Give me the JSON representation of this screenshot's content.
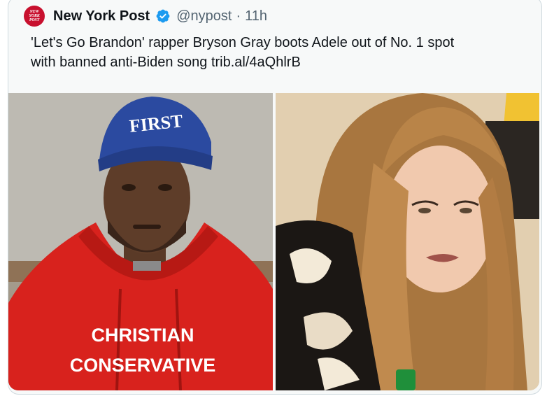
{
  "tweet": {
    "avatar_lines": [
      "NEW",
      "YORK",
      "POST"
    ],
    "author_name": "New York Post",
    "handle": "@nypost",
    "separator": "·",
    "time": "11h",
    "text_line1": "'Let's Go Brandon' rapper Bryson Gray boots Adele out of No. 1 spot",
    "text_line2": "with banned anti-Biden song trib.al/4aQhlrB"
  },
  "media": {
    "left_photo": {
      "cap_text": "FIRST",
      "hoodie_line1": "CHRISTIAN",
      "hoodie_line2": "CONSERVATIVE"
    }
  },
  "colors": {
    "verified_blue": "#1d9bf0",
    "secondary_text": "#536471",
    "avatar_red": "#c8102e"
  }
}
